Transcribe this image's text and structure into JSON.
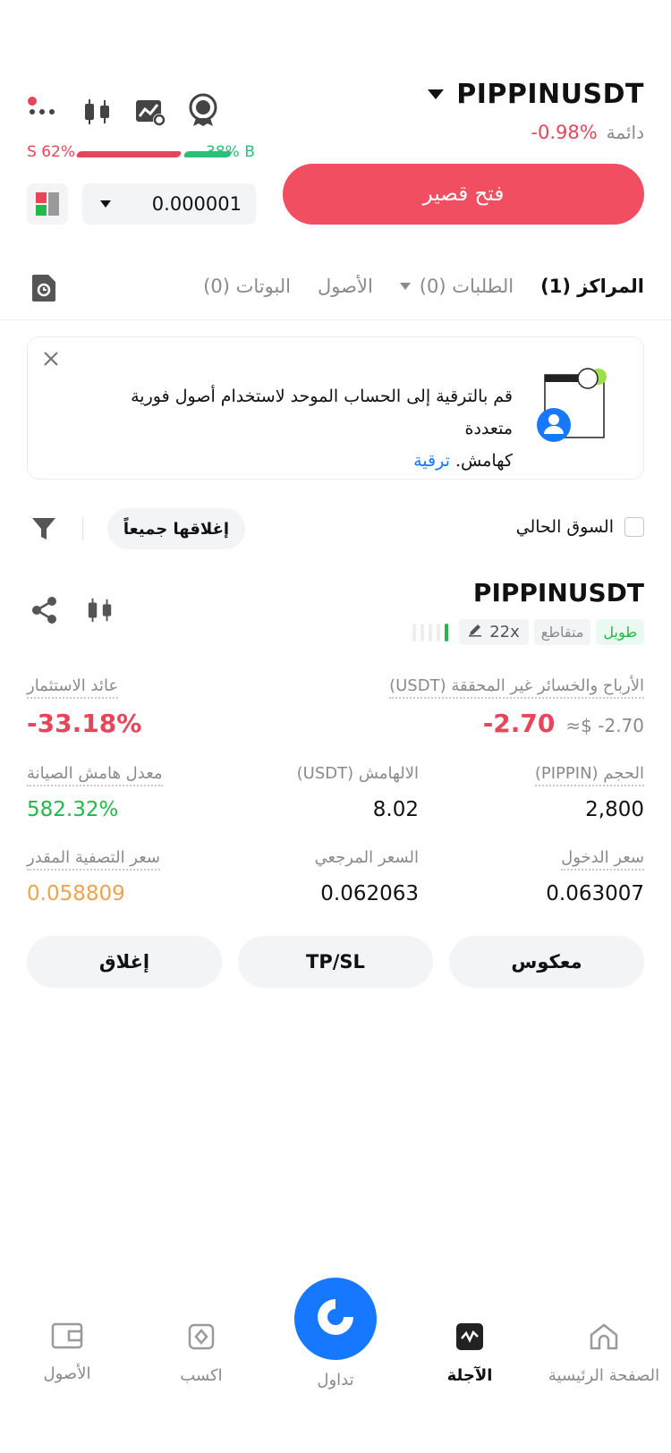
{
  "header": {
    "symbol": "PIPPINUSDT",
    "type_label": "دائمة",
    "change": "-0.98%"
  },
  "sentiment": {
    "sell_label": "S 62%",
    "buy_label": "38% B",
    "sell_fraction": 0.62,
    "buy_fraction": 0.38
  },
  "order": {
    "quantity_value": "0.000001",
    "open_short_label": "فتح قصير"
  },
  "tabs": {
    "positions": "المراكز (1)",
    "orders": "الطلبات (0)",
    "assets": "الأصول",
    "bots": "البوتات (0)"
  },
  "banner": {
    "text": "قم بالترقية إلى الحساب الموحد لاستخدام أصول فورية متعددة",
    "text2": "كهامش.",
    "link": "ترقية"
  },
  "filters": {
    "current_market": "السوق الحالي",
    "close_all": "إغلاقها جميعاً"
  },
  "position": {
    "symbol": "PIPPINUSDT",
    "side": "طويل",
    "margin_mode": "متقاطع",
    "leverage": "22x",
    "unrealized_pnl_label": "الأرباح والخسائر غير المحققة (USDT)",
    "unrealized_pnl": "-2.70",
    "unrealized_pnl_usd": "≈$ -2.70",
    "roi_label": "عائد الاستثمار",
    "roi": "-33.18%",
    "size_label": "الحجم (PIPPIN)",
    "size": "2,800",
    "margin_label": "الالهامش (USDT)",
    "margin": "8.02",
    "maint_margin_label": "معدل هامش الصيانة",
    "maint_margin": "582.32%",
    "entry_label": "سعر الدخول",
    "entry": "0.063007",
    "mark_label": "السعر المرجعي",
    "mark": "0.062063",
    "liq_label": "سعر التصفية المقدر",
    "liq": "0.058809",
    "reverse_btn": "معكوس",
    "tpsl_btn": "TP/SL",
    "close_btn": "إغلاق"
  },
  "bottom_nav": {
    "home": "الصفحة الرئيسية",
    "futures": "الآجلة",
    "trade": "تداول",
    "earn": "اكسب",
    "assets": "الأصول"
  },
  "colors": {
    "accent_red": "#f24e62",
    "green": "#21b94a",
    "blue": "#1677ff",
    "orange": "#f0a24c"
  }
}
